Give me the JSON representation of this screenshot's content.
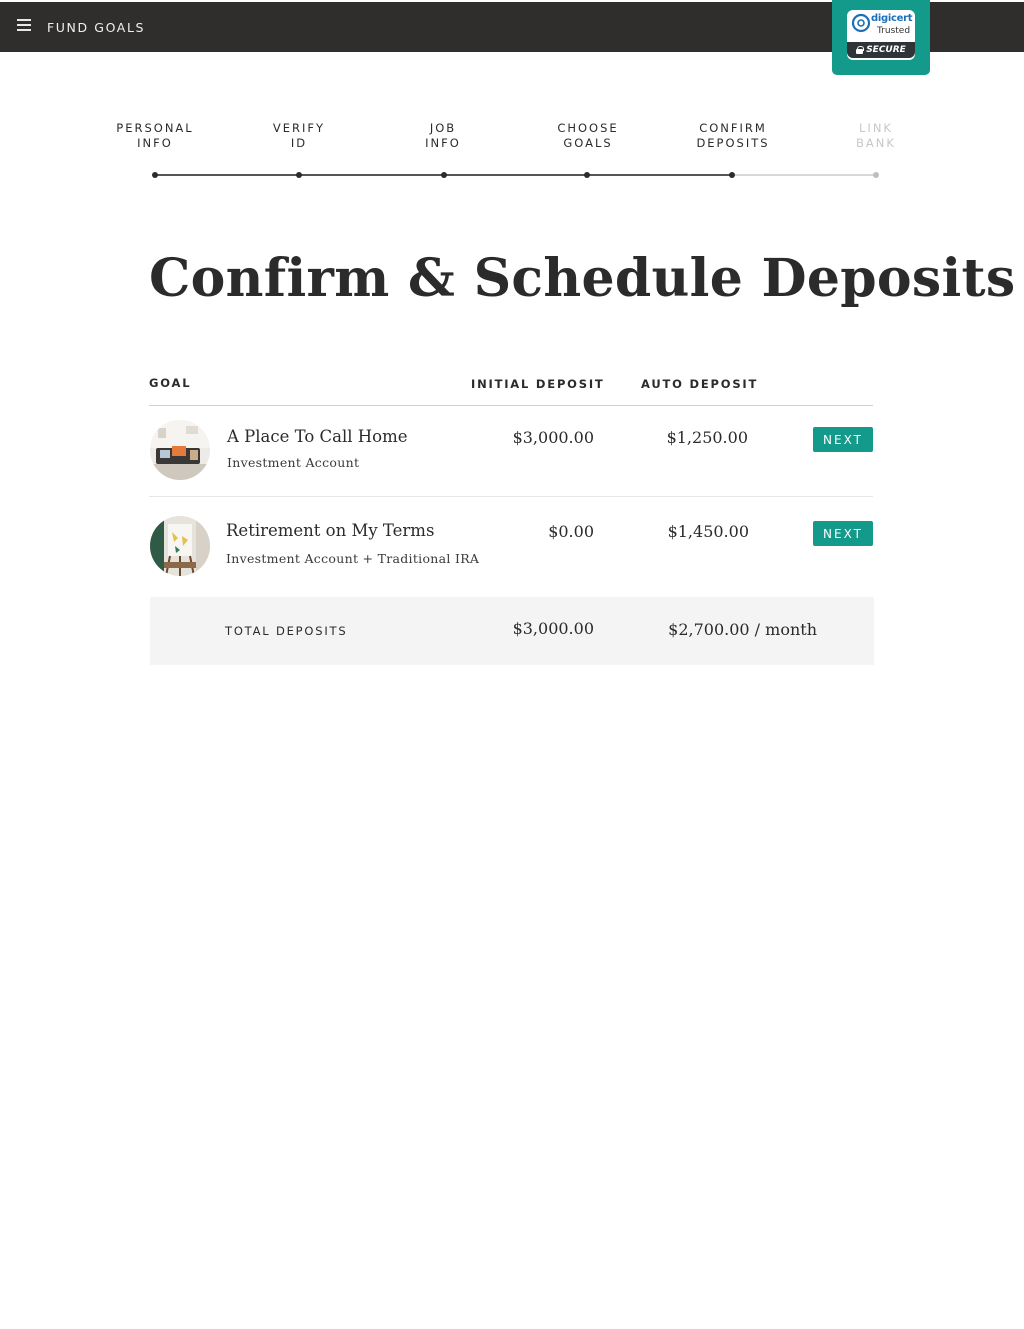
{
  "topbar": {
    "menu_icon": "hamburger-icon",
    "title": "FUND GOALS"
  },
  "badge": {
    "brand": "digicert",
    "trusted": "Trusted",
    "secure": "SECURE",
    "logo_icon": "digicert-logo-icon",
    "lock_icon": "lock-icon"
  },
  "stepper": {
    "steps": [
      {
        "line1": "PERSONAL",
        "line2": "INFO",
        "state": "done"
      },
      {
        "line1": "VERIFY",
        "line2": "ID",
        "state": "done"
      },
      {
        "line1": "JOB",
        "line2": "INFO",
        "state": "done"
      },
      {
        "line1": "CHOOSE",
        "line2": "GOALS",
        "state": "done"
      },
      {
        "line1": "CONFIRM",
        "line2": "DEPOSITS",
        "state": "current"
      },
      {
        "line1": "LINK",
        "line2": "BANK",
        "state": "upcoming"
      }
    ]
  },
  "page": {
    "title": "Confirm & Schedule Deposits"
  },
  "table": {
    "headers": {
      "goal": "GOAL",
      "initial": "INITIAL DEPOSIT",
      "auto": "AUTO DEPOSIT"
    },
    "rows": [
      {
        "name": "A Place To Call Home",
        "account": "Investment Account",
        "initial": "$3,000.00",
        "auto": "$1,250.00",
        "action": "NEXT"
      },
      {
        "name": "Retirement on My Terms",
        "account": "Investment Account + Traditional IRA",
        "initial": "$0.00",
        "auto": "$1,450.00",
        "action": "NEXT"
      }
    ],
    "total": {
      "label": "TOTAL DEPOSITS",
      "initial": "$3,000.00",
      "auto": "$2,700.00 / month"
    }
  },
  "colors": {
    "accent": "#149a8b",
    "topbar": "#2f2e2c",
    "total_row_bg": "#f4f4f4"
  }
}
